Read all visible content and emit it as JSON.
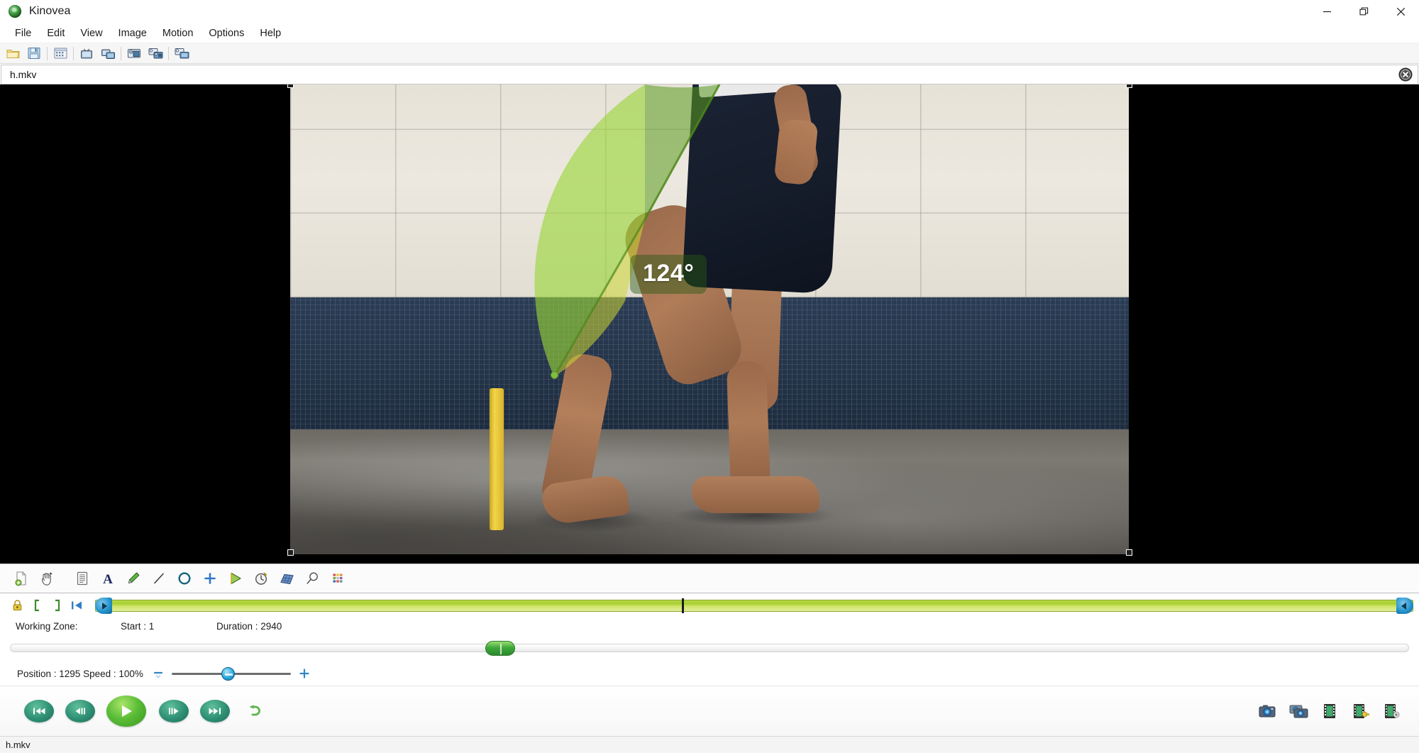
{
  "window": {
    "app_title": "Kinovea",
    "logo_icon": "kinovea-logo-icon",
    "minimize_label": "Minimize",
    "restore_label": "Restore",
    "close_label": "Close"
  },
  "menubar": {
    "items": [
      {
        "label": "File"
      },
      {
        "label": "Edit"
      },
      {
        "label": "View"
      },
      {
        "label": "Image"
      },
      {
        "label": "Motion"
      },
      {
        "label": "Options"
      },
      {
        "label": "Help"
      }
    ]
  },
  "main_toolbar": {
    "buttons": [
      {
        "name": "open-file-button",
        "icon": "folder-open-icon",
        "tooltip": "Open file"
      },
      {
        "name": "save-file-button",
        "icon": "floppy-save-icon",
        "tooltip": "Save"
      },
      {
        "name": "file-explorer-button",
        "icon": "explorer-window-icon",
        "tooltip": "File explorer"
      },
      {
        "name": "one-playback-screen-button",
        "icon": "single-screen-icon",
        "tooltip": "One playback screen"
      },
      {
        "name": "two-playback-screens-button",
        "icon": "dual-screen-icon",
        "tooltip": "Two playback screens"
      },
      {
        "name": "one-capture-screen-button",
        "icon": "single-capture-icon",
        "tooltip": "One capture screen"
      },
      {
        "name": "two-capture-screens-button",
        "icon": "dual-capture-icon",
        "tooltip": "Two capture screens"
      },
      {
        "name": "mixed-screens-button",
        "icon": "mixed-screen-icon",
        "tooltip": "Two mixed screens"
      }
    ]
  },
  "file_bar": {
    "filename": "h.mkv",
    "close_icon": "close-circle-icon"
  },
  "video": {
    "measurement_angle": "124°",
    "vertex_marker": "angle-vertex-handle",
    "angle_fill_color": "#8ccc3a",
    "angle_label_bg": "rgba(40,90,20,0.46)"
  },
  "annotation_toolbar": {
    "tools": [
      {
        "name": "new-keyframe-tool",
        "icon": "page-add-icon",
        "label": "Add key image"
      },
      {
        "name": "hand-tool",
        "icon": "hand-move-icon",
        "label": "Hand tool"
      },
      {
        "name": "comments-tool",
        "icon": "notes-page-icon",
        "label": "Comments"
      },
      {
        "name": "text-tool",
        "icon": "text-a-icon",
        "label": "Label"
      },
      {
        "name": "pencil-tool",
        "icon": "pencil-icon",
        "label": "Pencil"
      },
      {
        "name": "line-tool",
        "icon": "line-icon",
        "label": "Line"
      },
      {
        "name": "circle-tool",
        "icon": "circle-icon",
        "label": "Circle"
      },
      {
        "name": "marker-tool",
        "icon": "cross-marker-icon",
        "label": "Marker"
      },
      {
        "name": "angle-tool",
        "icon": "angle-triangle-icon",
        "label": "Angle"
      },
      {
        "name": "stopwatch-tool",
        "icon": "stopwatch-icon",
        "label": "Stopwatch"
      },
      {
        "name": "plane-grid-tool",
        "icon": "perspective-grid-icon",
        "label": "Perspective grid"
      },
      {
        "name": "magnifier-tool",
        "icon": "magnifier-icon",
        "label": "Magnifier"
      },
      {
        "name": "color-profile-tool",
        "icon": "color-palette-icon",
        "label": "Color profile"
      }
    ]
  },
  "timeline": {
    "zone_buttons": [
      {
        "name": "lock-working-zone-button",
        "icon": "padlock-icon",
        "label": "Lock working zone"
      },
      {
        "name": "set-zone-start-button",
        "icon": "bracket-left-icon",
        "label": "Set working zone start"
      },
      {
        "name": "set-zone-end-button",
        "icon": "bracket-right-icon",
        "label": "Set working zone end"
      },
      {
        "name": "reset-working-zone-button",
        "icon": "reset-zone-icon",
        "label": "Reset working zone"
      }
    ],
    "working_zone_label": "Working Zone:",
    "start_label": "Start : 1",
    "duration_label": "Duration : 2940",
    "playhead_percent": 44.5,
    "left_handle_icon": "zone-start-handle-icon",
    "right_handle_icon": "zone-end-handle-icon"
  },
  "scroll_slider": {
    "thumb_position_percent": 34.0,
    "thumb_icon": "scroll-thumb-icon"
  },
  "speed": {
    "position_label": "Position : 1295",
    "speed_label": "Speed : 100%",
    "combined_label": "Position : 1295  Speed : 100%",
    "decrease_icon": "minus-icon",
    "increase_icon": "plus-icon",
    "slider_percent": 47
  },
  "playback": {
    "buttons": [
      {
        "name": "go-to-start-button",
        "icon": "skip-to-start-icon",
        "label": "First image"
      },
      {
        "name": "previous-frame-button",
        "icon": "step-backward-icon",
        "label": "Previous image"
      },
      {
        "name": "play-button",
        "icon": "play-icon",
        "label": "Play"
      },
      {
        "name": "next-frame-button",
        "icon": "step-forward-icon",
        "label": "Next image"
      },
      {
        "name": "go-to-end-button",
        "icon": "skip-to-end-icon",
        "label": "Last image"
      },
      {
        "name": "loop-button",
        "icon": "loop-arrow-icon",
        "label": "Loop"
      }
    ]
  },
  "export": {
    "buttons": [
      {
        "name": "save-image-button",
        "icon": "camera-icon",
        "label": "Save image"
      },
      {
        "name": "save-image-sequence-button",
        "icon": "dual-camera-icon",
        "label": "Save image sequence"
      },
      {
        "name": "save-video-button",
        "icon": "film-strip-icon",
        "label": "Save video"
      },
      {
        "name": "save-video-with-pauses-button",
        "icon": "film-key-icon",
        "label": "Save video with key images"
      },
      {
        "name": "save-diaporama-button",
        "icon": "film-gear-icon",
        "label": "Save diaporama"
      }
    ]
  },
  "statusbar": {
    "text": "h.mkv"
  }
}
